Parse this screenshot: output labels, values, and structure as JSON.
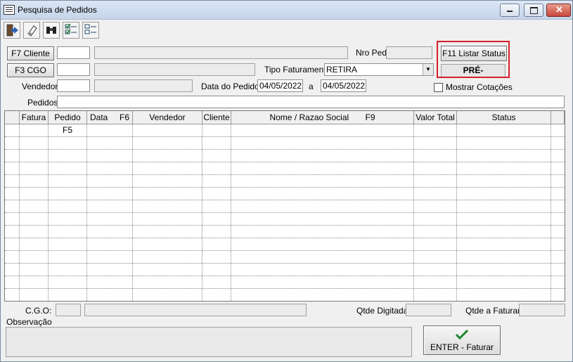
{
  "window": {
    "title": "Pesquisa de Pedidos"
  },
  "toolbar": {
    "icons": [
      "exit-icon",
      "eraser-icon",
      "binoculars-icon",
      "check-list-icon",
      "uncheck-list-icon"
    ]
  },
  "filters": {
    "cliente_button": "F7 Cliente",
    "cgo_button": "F3 CGO",
    "nro_ped_label": "Nro Ped",
    "listar_status_button": "F11 Listar Status",
    "status_value": "PRÉ-",
    "tipo_faturamento_label": "Tipo Faturamento",
    "tipo_faturamento_value": "RETIRA",
    "vendedor_label": "Vendedor",
    "data_pedido_label": "Data do Pedido",
    "data_inicio": "04/05/2022",
    "data_sep": "a",
    "data_fim": "04/05/2022",
    "mostrar_cotacoes_label": "Mostrar Cotações",
    "pedidos_label": "Pedidos"
  },
  "grid": {
    "columns": [
      "Fatura",
      "Pedido F5",
      "Data     F6",
      "Vendedor",
      "Cliente",
      "Nome / Razao Social       F9",
      "Valor Total",
      "Status"
    ]
  },
  "footer": {
    "cgo_label": "C.G.O:",
    "qtde_digitada_label": "Qtde Digitada",
    "qtde_faturar_label": "Qtde a Faturar",
    "observacao_label": "Observação",
    "enter_button": "ENTER - Faturar"
  },
  "colors": {
    "highlight": "#d4202c",
    "check": "#1e8a2e"
  }
}
